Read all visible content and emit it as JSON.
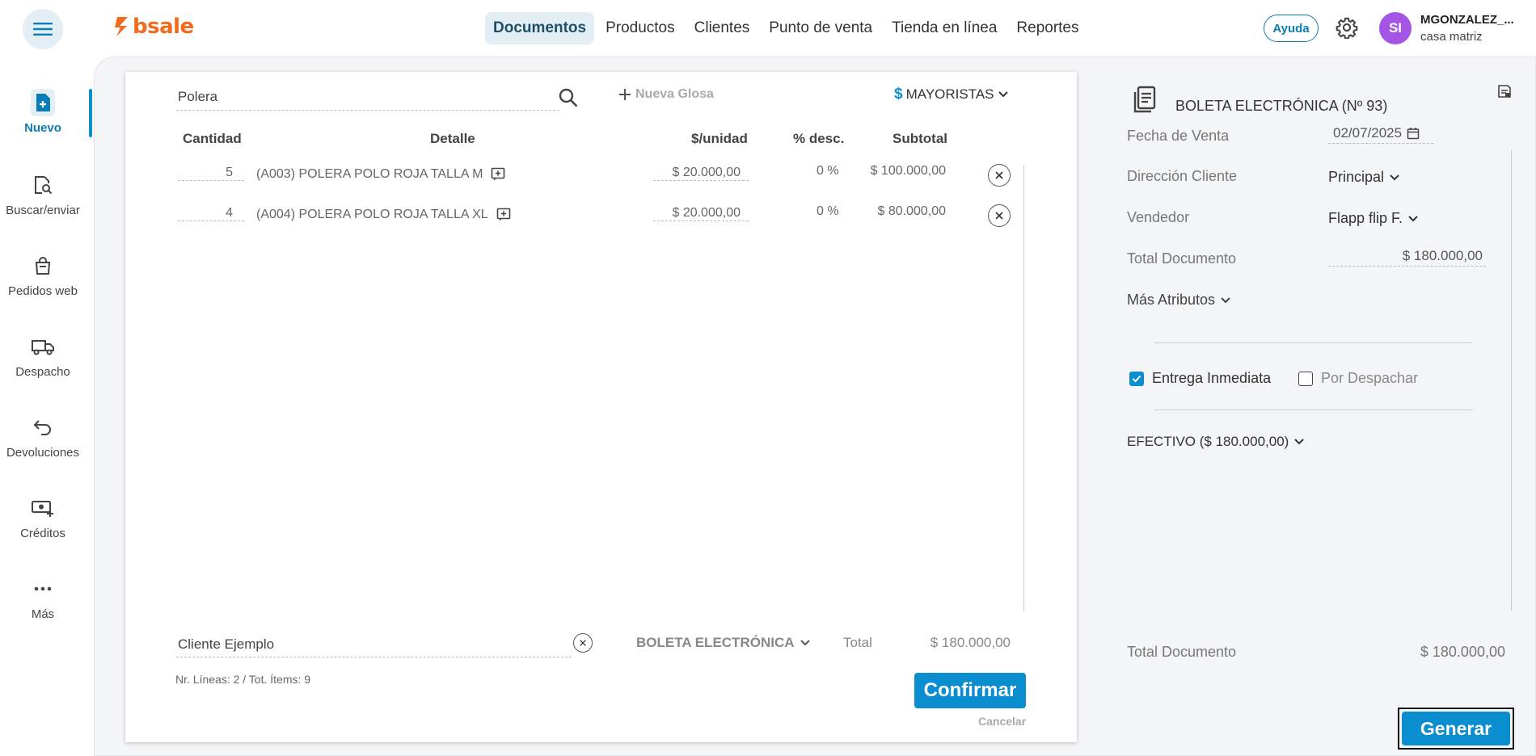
{
  "header": {
    "logo_text": "bsale",
    "nav": [
      "Documentos",
      "Productos",
      "Clientes",
      "Punto de venta",
      "Tienda en línea",
      "Reportes"
    ],
    "help_label": "Ayuda",
    "avatar_initials": "SI",
    "user_name": "MGONZALEZ_...",
    "user_branch": "casa matriz"
  },
  "sidebar": {
    "items": [
      {
        "label": "Nuevo"
      },
      {
        "label": "Buscar/enviar"
      },
      {
        "label": "Pedidos web"
      },
      {
        "label": "Despacho"
      },
      {
        "label": "Devoluciones"
      },
      {
        "label": "Créditos"
      },
      {
        "label": "Más"
      }
    ]
  },
  "document": {
    "search_value": "Polera",
    "nueva_glosa": "Nueva Glosa",
    "price_list_symbol": "$",
    "price_list": "MAYORISTAS",
    "columns": {
      "cantidad": "Cantidad",
      "detalle": "Detalle",
      "unidad": "$/unidad",
      "desc": "% desc.",
      "subtotal": "Subtotal"
    },
    "rows": [
      {
        "qty": "5",
        "detail": "(A003) POLERA POLO ROJA TALLA M",
        "unit_price": "$ 20.000,00",
        "discount": "0 %",
        "subtotal": "$ 100.000,00"
      },
      {
        "qty": "4",
        "detail": "(A004) POLERA POLO ROJA TALLA XL",
        "unit_price": "$ 20.000,00",
        "discount": "0 %",
        "subtotal": "$ 80.000,00"
      }
    ],
    "client_value": "Cliente Ejemplo",
    "doc_type": "BOLETA ELECTRÓNICA",
    "total_label": "Total",
    "total_value": "$ 180.000,00",
    "lines_summary": "Nr. Líneas: 2 / Tot. Ítems: 9",
    "confirm_label": "Confirmar",
    "cancel_label": "Cancelar"
  },
  "panel": {
    "doc_title": "BOLETA ELECTRÓNICA (Nº 93)",
    "fecha_label": "Fecha de Venta",
    "fecha_value": "02/07/2025",
    "direccion_label": "Dirección Cliente",
    "direccion_value": "Principal",
    "vendedor_label": "Vendedor",
    "vendedor_value": "Flapp flip F.",
    "total_doc_label": "Total Documento",
    "total_doc_value": "$ 180.000,00",
    "mas_atributos": "Más Atributos",
    "entrega_inmediata": "Entrega Inmediata",
    "por_despachar": "Por Despachar",
    "pago": "EFECTIVO ($ 180.000,00)",
    "footer_total_label": "Total Documento",
    "footer_total_value": "$ 180.000,00",
    "generar_label": "Generar"
  },
  "colors": {
    "accent": "#0b8ed0",
    "brand": "#f26a1b",
    "avatar": "#a455e6"
  }
}
